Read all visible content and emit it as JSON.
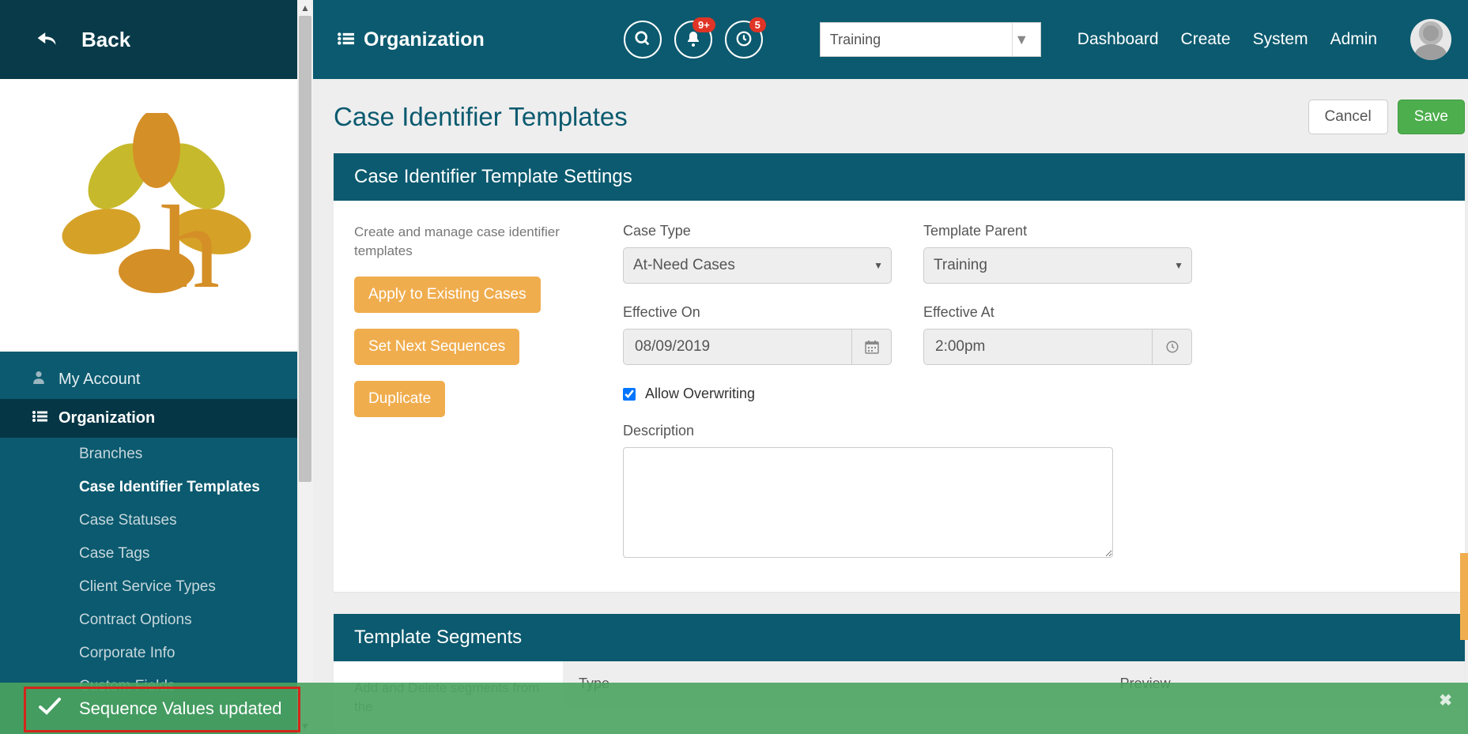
{
  "sidebar": {
    "back_label": "Back",
    "nav_my_account": "My Account",
    "nav_organization": "Organization",
    "subnav": {
      "branches": "Branches",
      "case_identifier_templates": "Case Identifier Templates",
      "case_statuses": "Case Statuses",
      "case_tags": "Case Tags",
      "client_service_types": "Client Service Types",
      "contract_options": "Contract Options",
      "corporate_info": "Corporate Info",
      "custom_fields": "Custom Fields"
    }
  },
  "toast": {
    "message": "Sequence Values updated"
  },
  "topnav": {
    "title": "Organization",
    "badge_notifications": "9+",
    "badge_history": "5",
    "org_select_value": "Training",
    "links": {
      "dashboard": "Dashboard",
      "create": "Create",
      "system": "System",
      "admin": "Admin"
    }
  },
  "page": {
    "title": "Case Identifier Templates",
    "cancel": "Cancel",
    "save": "Save"
  },
  "settings_panel": {
    "header": "Case Identifier Template Settings",
    "description": "Create and manage case identifier templates",
    "apply_btn": "Apply to Existing Cases",
    "set_next_btn": "Set Next Sequences",
    "duplicate_btn": "Duplicate",
    "case_type_label": "Case Type",
    "case_type_value": "At-Need Cases",
    "template_parent_label": "Template Parent",
    "template_parent_value": "Training",
    "effective_on_label": "Effective On",
    "effective_on_value": "08/09/2019",
    "effective_at_label": "Effective At",
    "effective_at_value": "2:00pm",
    "allow_overwriting_label": "Allow Overwriting",
    "description_label": "Description"
  },
  "segments_panel": {
    "header": "Template Segments",
    "left_text": "Add and Delete segments from the",
    "col_type": "Type",
    "col_preview": "Preview"
  }
}
